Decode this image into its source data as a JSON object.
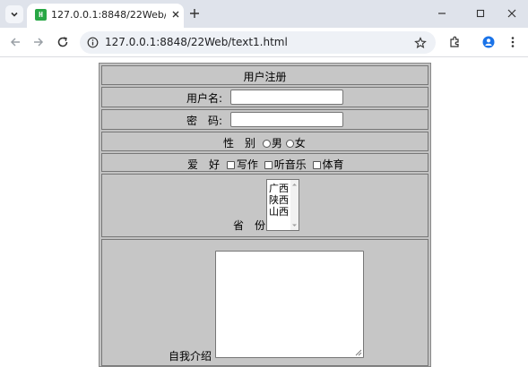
{
  "browser": {
    "tab_title": "127.0.0.1:8848/22Web/text1.h",
    "favicon_text": "H",
    "url": "127.0.0.1:8848/22Web/text1.html"
  },
  "form": {
    "title": "用户注册",
    "username_label": "用户名:",
    "password_label": "密　码:",
    "gender_label": "性　别",
    "gender_options": [
      "男",
      "女"
    ],
    "hobby_label": "爱　好",
    "hobby_options": [
      "写作",
      "听音乐",
      "体育"
    ],
    "province_label": "省　份",
    "province_options": [
      "广西",
      "陕西",
      "山西"
    ],
    "intro_label": "自我介绍"
  }
}
